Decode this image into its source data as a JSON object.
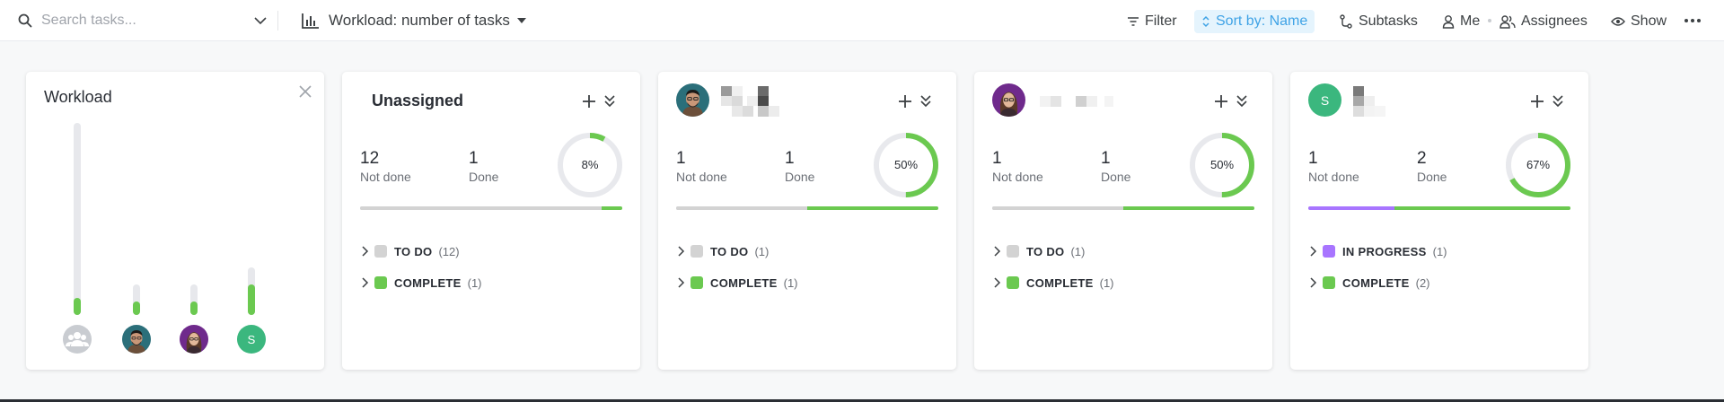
{
  "toolbar": {
    "search_placeholder": "Search tasks...",
    "workload_label": "Workload: number of tasks",
    "filter_label": "Filter",
    "sort_label": "Sort by: Name",
    "subtasks_label": "Subtasks",
    "me_label": "Me",
    "assignees_label": "Assignees",
    "show_label": "Show"
  },
  "workload_panel": {
    "title": "Workload",
    "bars": [
      {
        "avatar": "group",
        "level": 0.09
      },
      {
        "avatar": "photo-man",
        "level": 0.45
      },
      {
        "avatar": "photo-woman",
        "level": 0.45
      },
      {
        "avatar": "initial",
        "initial": "S",
        "level": 0.65
      }
    ]
  },
  "cards": [
    {
      "title": "Unassigned",
      "avatar": "none",
      "not_done": "12",
      "not_done_label": "Not done",
      "done": "1",
      "done_label": "Done",
      "percent_text": "8%",
      "percent": 8,
      "progress": {
        "todo": 0.92,
        "inprogress": 0,
        "done": 0.08
      },
      "groups": [
        {
          "name": "TO DO",
          "count": "(12)",
          "color": "#d3d3d3"
        },
        {
          "name": "COMPLETE",
          "count": "(1)",
          "color": "#6bc950"
        }
      ]
    },
    {
      "title": "",
      "avatar": "photo-man",
      "not_done": "1",
      "not_done_label": "Not done",
      "done": "1",
      "done_label": "Done",
      "percent_text": "50%",
      "percent": 50,
      "progress": {
        "todo": 0.5,
        "inprogress": 0,
        "done": 0.5
      },
      "groups": [
        {
          "name": "TO DO",
          "count": "(1)",
          "color": "#d3d3d3"
        },
        {
          "name": "COMPLETE",
          "count": "(1)",
          "color": "#6bc950"
        }
      ]
    },
    {
      "title": "",
      "avatar": "photo-woman",
      "not_done": "1",
      "not_done_label": "Not done",
      "done": "1",
      "done_label": "Done",
      "percent_text": "50%",
      "percent": 50,
      "progress": {
        "todo": 0.5,
        "inprogress": 0,
        "done": 0.5
      },
      "groups": [
        {
          "name": "TO DO",
          "count": "(1)",
          "color": "#d3d3d3"
        },
        {
          "name": "COMPLETE",
          "count": "(1)",
          "color": "#6bc950"
        }
      ]
    },
    {
      "title": "",
      "avatar": "initial",
      "initial": "S",
      "not_done": "1",
      "not_done_label": "Not done",
      "done": "2",
      "done_label": "Done",
      "percent_text": "67%",
      "percent": 67,
      "progress": {
        "todo": 0,
        "inprogress": 0.33,
        "done": 0.67
      },
      "groups": [
        {
          "name": "IN PROGRESS",
          "count": "(1)",
          "color": "#a875ff"
        },
        {
          "name": "COMPLETE",
          "count": "(2)",
          "color": "#6bc950"
        }
      ]
    }
  ],
  "colors": {
    "accent": "#3fa3e6",
    "done_green": "#6bc950",
    "in_progress_purple": "#a875ff",
    "todo_grey": "#d3d3d3",
    "avatar_initial_bg": "#3bb77e"
  }
}
